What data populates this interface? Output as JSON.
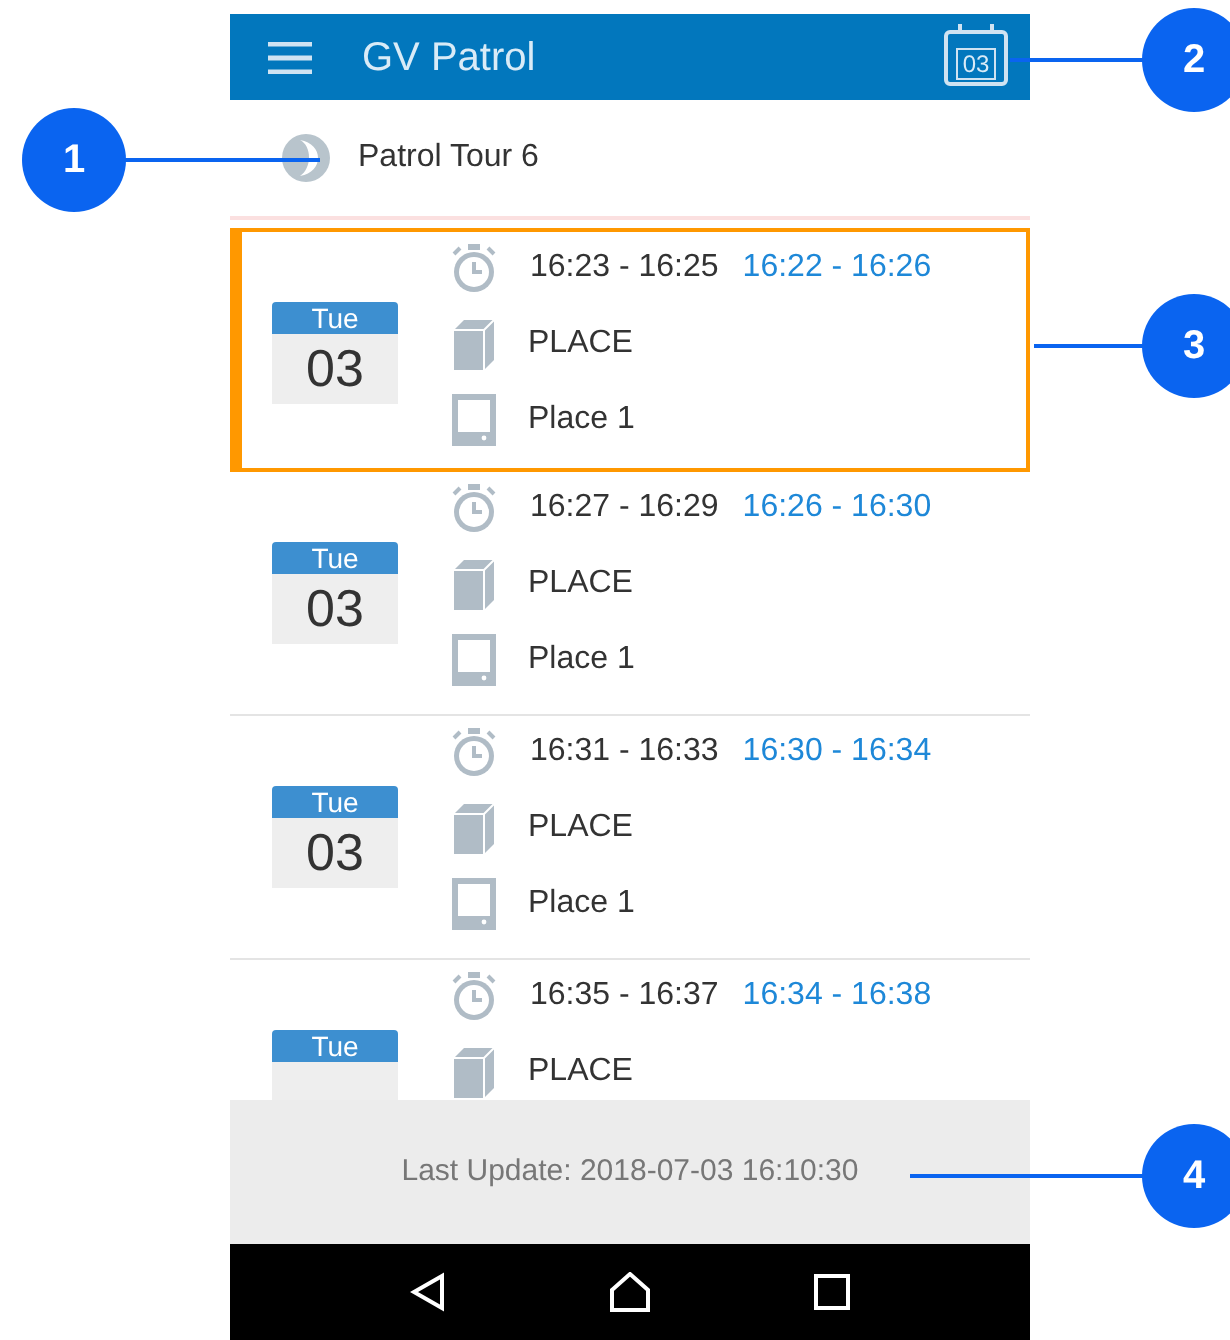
{
  "app_bar": {
    "title": "GV Patrol",
    "calendar_day": "03"
  },
  "tour": {
    "name": "Patrol Tour 6"
  },
  "checkpoints": [
    {
      "weekday": "Tue",
      "day": "03",
      "planned": "16:23 - 16:25",
      "window": "16:22 - 16:26",
      "place_type": "PLACE",
      "place": "Place 1",
      "selected": true
    },
    {
      "weekday": "Tue",
      "day": "03",
      "planned": "16:27 - 16:29",
      "window": "16:26 - 16:30",
      "place_type": "PLACE",
      "place": "Place 1",
      "selected": false
    },
    {
      "weekday": "Tue",
      "day": "03",
      "planned": "16:31 - 16:33",
      "window": "16:30 - 16:34",
      "place_type": "PLACE",
      "place": "Place 1",
      "selected": false
    },
    {
      "weekday": "Tue",
      "planned": "16:35 - 16:37",
      "window": "16:34 - 16:38",
      "place_type": "PLACE",
      "selected": false
    }
  ],
  "footer": {
    "last_update": "Last Update: 2018-07-03 16:10:30"
  },
  "callouts": [
    "1",
    "2",
    "3",
    "4"
  ]
}
